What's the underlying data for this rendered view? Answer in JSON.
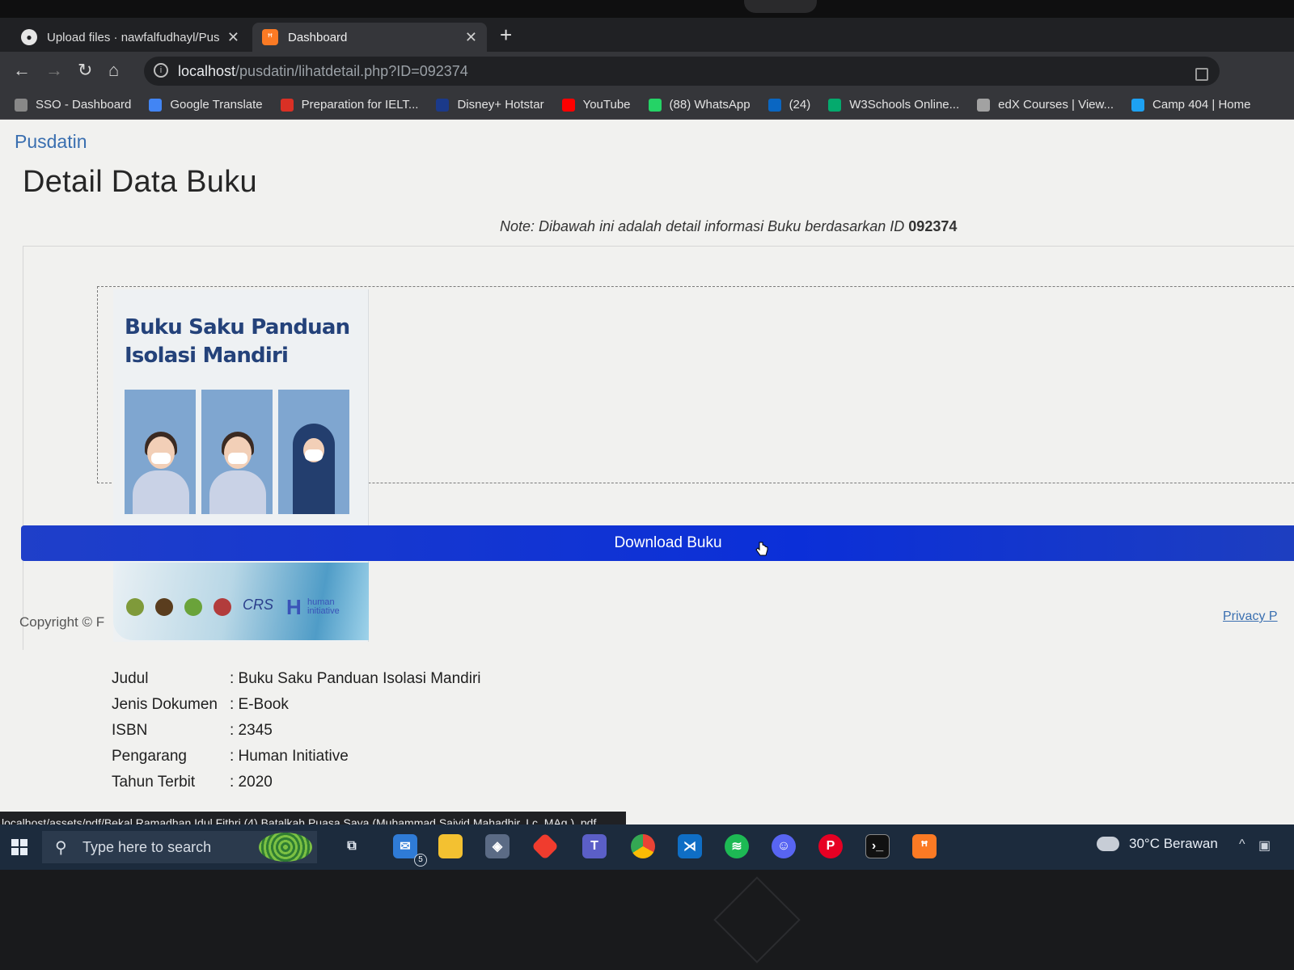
{
  "browser": {
    "tabs": [
      {
        "title": "Upload files · nawfalfudhayl/Pus",
        "icon": "github-icon",
        "active": false
      },
      {
        "title": "Dashboard",
        "icon": "xampp-icon",
        "active": true
      }
    ],
    "url_host": "localhost",
    "url_path": "/pusdatin/lihatdetail.php?ID=092374",
    "bookmarks": [
      {
        "label": "SSO - Dashboard",
        "color": "#888888"
      },
      {
        "label": "Google Translate",
        "color": "#4285f4"
      },
      {
        "label": "Preparation for IELT...",
        "color": "#d93025"
      },
      {
        "label": "Disney+ Hotstar",
        "color": "#1b3a8a"
      },
      {
        "label": "YouTube",
        "color": "#ff0000"
      },
      {
        "label": "(88) WhatsApp",
        "color": "#25d366"
      },
      {
        "label": "(24)",
        "color": "#0a66c2"
      },
      {
        "label": "W3Schools Online...",
        "color": "#04aa6d"
      },
      {
        "label": "edX Courses | View...",
        "color": "#a2a2a2"
      },
      {
        "label": "Camp 404 | Home",
        "color": "#1da1f2"
      }
    ]
  },
  "page": {
    "brand": "Pusdatin",
    "title": "Detail Data Buku",
    "note_prefix": "Note: Dibawah ini adalah detail informasi Buku berdasarkan ID",
    "note_id": "092374",
    "cover": {
      "title_line1": "Buku Saku Panduan",
      "title_line2": "Isolasi Mandiri",
      "logo_text": "CRS",
      "hi_text": "human initiative"
    },
    "download_label": "Download Buku",
    "copyright": "Copyright © F",
    "privacy": "Privacy P",
    "details": [
      {
        "key": "Judul",
        "value": ": Buku Saku Panduan Isolasi Mandiri"
      },
      {
        "key": "Jenis Dokumen",
        "value": ": E-Book"
      },
      {
        "key": "ISBN",
        "value": ": 2345"
      },
      {
        "key": "Pengarang",
        "value": ": Human Initiative"
      },
      {
        "key": "Tahun Terbit",
        "value": ": 2020"
      }
    ]
  },
  "status_bar": "localhost/assets/pdf/Bekal Ramadhan  Idul Fithri (4)  Batalkah Puasa Saya (Muhammad Saiyid Mahadhir, Lc.,MAg.) .pdf",
  "taskbar": {
    "search_placeholder": "Type here to search",
    "mail_badge": "5",
    "weather": "30°C  Berawan",
    "apps": [
      "task-view",
      "mail",
      "file-explorer",
      "virtualbox",
      "git",
      "teams",
      "chrome",
      "vscode",
      "spotify",
      "discord",
      "pinterest",
      "terminal",
      "xampp"
    ]
  }
}
